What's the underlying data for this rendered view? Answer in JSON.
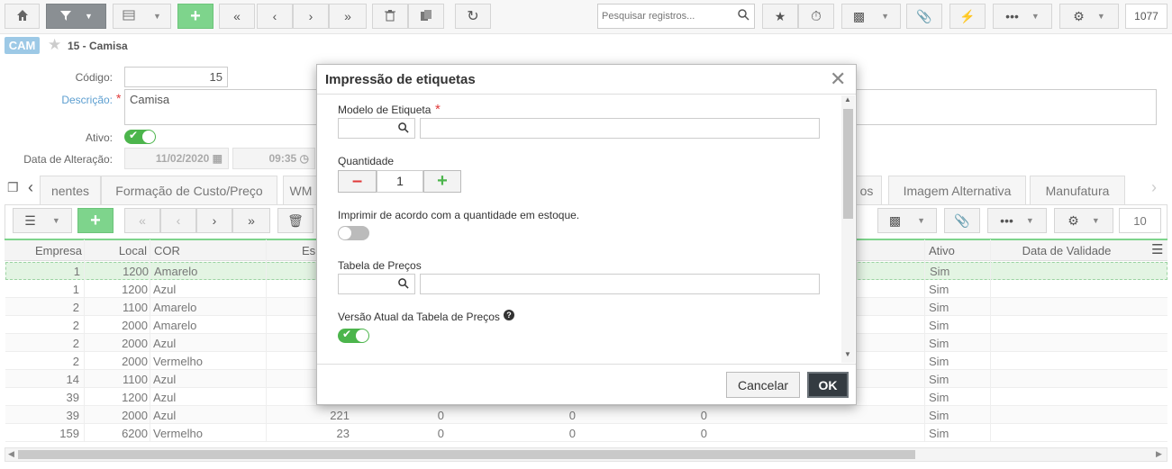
{
  "toolbar": {
    "search_placeholder": "Pesquisar registros...",
    "record_count": "1077"
  },
  "breadcrumb": {
    "badge": "CAM",
    "title": "15 - Camisa"
  },
  "form": {
    "codigo_label": "Código:",
    "codigo_value": "15",
    "descricao_label": "Descrição:",
    "descricao_value": "Camisa",
    "required_mark": "*",
    "ativo_label": "Ativo:",
    "data_label": "Data de Alteração:",
    "data_value": "11/02/2020",
    "hora_value": "09:35"
  },
  "tabs": [
    {
      "label": "nentes"
    },
    {
      "label": "Formação de Custo/Preço"
    },
    {
      "label": "WM"
    },
    {
      "label": "os"
    },
    {
      "label": "Imagem Alternativa"
    },
    {
      "label": "Manufatura"
    }
  ],
  "grid": {
    "page_size": "10",
    "columns": {
      "empresa": "Empresa",
      "local": "Local",
      "cor": "COR",
      "es": "Es",
      "ativo": "Ativo",
      "validade": "Data de Validade"
    },
    "rows": [
      {
        "empresa": "1",
        "local": "1200",
        "cor": "Amarelo",
        "es": "",
        "c1": "",
        "c2": "",
        "c3": "",
        "ativo": "Sim"
      },
      {
        "empresa": "1",
        "local": "1200",
        "cor": "Azul",
        "es": "",
        "c1": "",
        "c2": "",
        "c3": "",
        "ativo": "Sim"
      },
      {
        "empresa": "2",
        "local": "1100",
        "cor": "Amarelo",
        "es": "",
        "c1": "",
        "c2": "",
        "c3": "",
        "ativo": "Sim"
      },
      {
        "empresa": "2",
        "local": "2000",
        "cor": "Amarelo",
        "es": "",
        "c1": "",
        "c2": "",
        "c3": "",
        "ativo": "Sim"
      },
      {
        "empresa": "2",
        "local": "2000",
        "cor": "Azul",
        "es": "",
        "c1": "",
        "c2": "",
        "c3": "",
        "ativo": "Sim"
      },
      {
        "empresa": "2",
        "local": "2000",
        "cor": "Vermelho",
        "es": "",
        "c1": "",
        "c2": "",
        "c3": "",
        "ativo": "Sim"
      },
      {
        "empresa": "14",
        "local": "1100",
        "cor": "Azul",
        "es": "",
        "c1": "",
        "c2": "",
        "c3": "",
        "ativo": "Sim"
      },
      {
        "empresa": "39",
        "local": "1200",
        "cor": "Azul",
        "es": "",
        "c1": "",
        "c2": "",
        "c3": "",
        "ativo": "Sim"
      },
      {
        "empresa": "39",
        "local": "2000",
        "cor": "Azul",
        "es": "221",
        "c1": "0",
        "c2": "0",
        "c3": "0",
        "ativo": "Sim"
      },
      {
        "empresa": "159",
        "local": "6200",
        "cor": "Vermelho",
        "es": "23",
        "c1": "0",
        "c2": "0",
        "c3": "0",
        "ativo": "Sim"
      }
    ]
  },
  "modal": {
    "title": "Impressão de etiquetas",
    "modelo_label": "Modelo de Etiqueta",
    "required_mark": "*",
    "quantidade_label": "Quantidade",
    "quantidade_value": "1",
    "estoque_label": "Imprimir de acordo com a quantidade em estoque.",
    "tabela_label": "Tabela de Preços",
    "versao_label": "Versão Atual da Tabela de Preços",
    "cancel_label": "Cancelar",
    "ok_label": "OK"
  },
  "colors": {
    "accent_green": "#7ed48c",
    "selected_row": "#e3f4e3",
    "badge_blue": "#9dc9e6",
    "required_red": "#e03a3a",
    "ok_dark": "#343b41"
  }
}
